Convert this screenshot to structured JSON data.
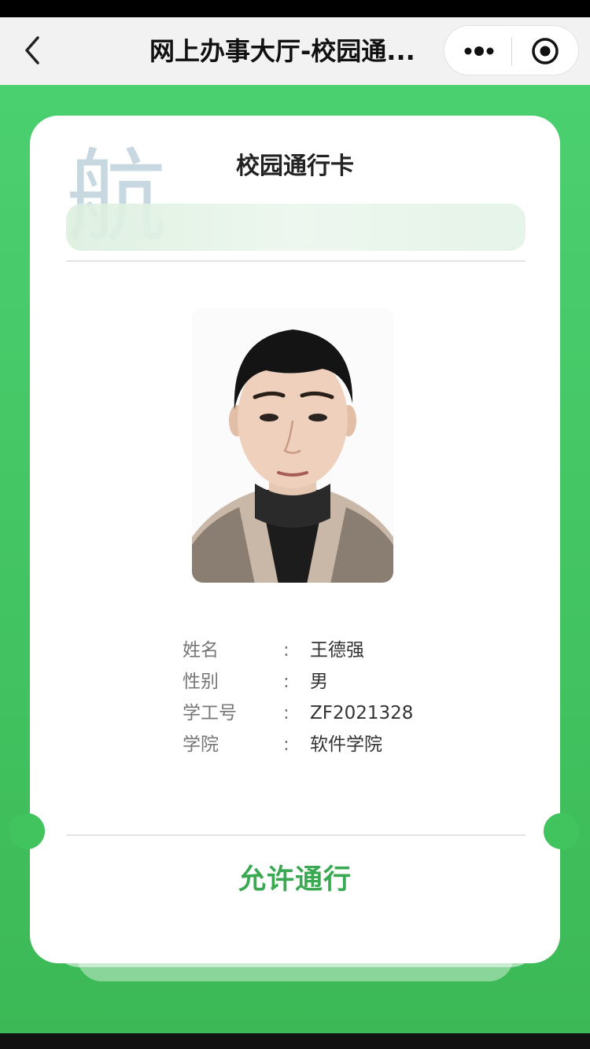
{
  "nav": {
    "title": "网上办事大厅-校园通...",
    "back_icon": "chevron-left-icon",
    "more_icon": "more-dots-icon",
    "close_icon": "target-close-icon"
  },
  "card": {
    "title": "校园通行卡",
    "watermark": "航",
    "photo_icon": "portrait-photo",
    "fields": [
      {
        "label": "姓名",
        "colon": ":",
        "value": "王德强"
      },
      {
        "label": "性别",
        "colon": ":",
        "value": "男"
      },
      {
        "label": "学工号",
        "colon": ":",
        "value": "ZF2021328"
      },
      {
        "label": "学院",
        "colon": ":",
        "value": "软件学院"
      }
    ],
    "status": "允许通行"
  },
  "colors": {
    "background_green": "#3cb956",
    "status_green": "#3aa952",
    "card_white": "#ffffff"
  }
}
